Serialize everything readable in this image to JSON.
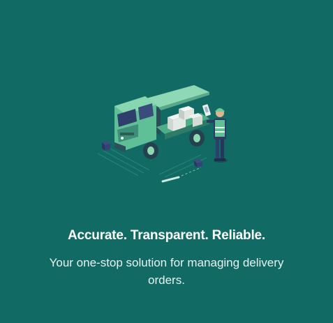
{
  "onboarding": {
    "illustration_icon": "delivery-truck-icon",
    "headline": "Accurate. Transparent. Reliable.",
    "subline": "Your one-stop solution for managing delivery orders."
  },
  "colors": {
    "background": "#116a64",
    "truck_body": "#5fbf96",
    "truck_dark": "#2e4f5c",
    "text": "#ffffff"
  }
}
